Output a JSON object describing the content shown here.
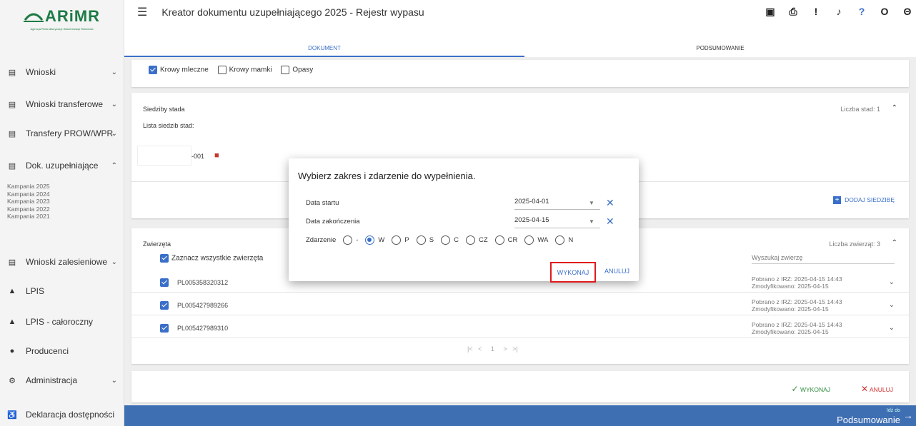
{
  "logo": {
    "name": "ARiMR",
    "sub": "Agencja Restrukturyzacji i Modernizacji Rolnictwa"
  },
  "sidebar": {
    "items": [
      {
        "label": "Wnioski",
        "icon": "doc-icon",
        "chev": "⌄"
      },
      {
        "label": "Wnioski transferowe",
        "icon": "doc-icon",
        "chev": "⌄"
      },
      {
        "label": "Transfery PROW/WPR",
        "icon": "doc-icon",
        "chev": "⌄"
      },
      {
        "label": "Dok. uzupełniające",
        "icon": "doc-icon",
        "chev": "⌃"
      },
      {
        "label": "Wnioski zalesieniowe",
        "icon": "doc-icon",
        "chev": "⌄"
      },
      {
        "label": "LPIS",
        "icon": "mountain-icon",
        "chev": ""
      },
      {
        "label": "LPIS - całoroczny",
        "icon": "mountain-icon",
        "chev": ""
      },
      {
        "label": "Producenci",
        "icon": "person-icon",
        "chev": ""
      },
      {
        "label": "Administracja",
        "icon": "admin-icon",
        "chev": "⌄"
      },
      {
        "label": "Deklaracja dostępności",
        "icon": "accessibility-icon",
        "chev": ""
      }
    ],
    "sub_items": [
      "Kampania 2025",
      "Kampania 2024",
      "Kampania 2023",
      "Kampania 2022",
      "Kampania 2021"
    ]
  },
  "header": {
    "title": "Kreator dokumentu uzupełniającego 2025 - Rejestr wypasu"
  },
  "tabs": {
    "doc": "DOKUMENT",
    "summary": "PODSUMOWANIE"
  },
  "types": {
    "dairy": "Krowy mleczne",
    "nurse": "Krowy mamki",
    "fattening": "Opasy"
  },
  "herd": {
    "section": "Siedziby stada",
    "count_label": "Liczba stad: 1",
    "list_label": "Lista siedzib stad:",
    "item_suffix": "-001",
    "add_label": "DODAJ SIEDZIBĘ"
  },
  "animals": {
    "section": "Zwierzęta",
    "count_label": "Liczba zwierząt: 3",
    "select_all": "Zaznacz wszystkie zwierzęta",
    "search": "Wyszukaj zwierzę",
    "rows": [
      {
        "id": "PL005358320312",
        "downloaded": "Pobrano z IRZ: 2025-04-15 14:43",
        "modified": "Zmodyfikowano: 2025-04-15"
      },
      {
        "id": "PL005427989266",
        "downloaded": "Pobrano z IRZ: 2025-04-15 14:43",
        "modified": "Zmodyfikowano: 2025-04-15"
      },
      {
        "id": "PL005427989310",
        "downloaded": "Pobrano z IRZ: 2025-04-15 14:43",
        "modified": "Zmodyfikowano: 2025-04-15"
      }
    ],
    "pager": "|<   <     1     >   >|"
  },
  "actions": {
    "execute": "WYKONAJ",
    "cancel": "ANULUJ"
  },
  "footer": {
    "small": "Idź do",
    "big": "Podsumowanie"
  },
  "dialog": {
    "title": "Wybierz zakres i zdarzenie do wypełnienia.",
    "start_label": "Data startu",
    "start_value": "2025-04-01",
    "end_label": "Data zakończenia",
    "end_value": "2025-04-15",
    "event_label": "Zdarzenie",
    "events": [
      "-",
      "W",
      "P",
      "S",
      "C",
      "CZ",
      "CR",
      "WA",
      "N"
    ],
    "selected_event": "W",
    "ok": "WYKONAJ",
    "cancel": "ANULUJ"
  }
}
